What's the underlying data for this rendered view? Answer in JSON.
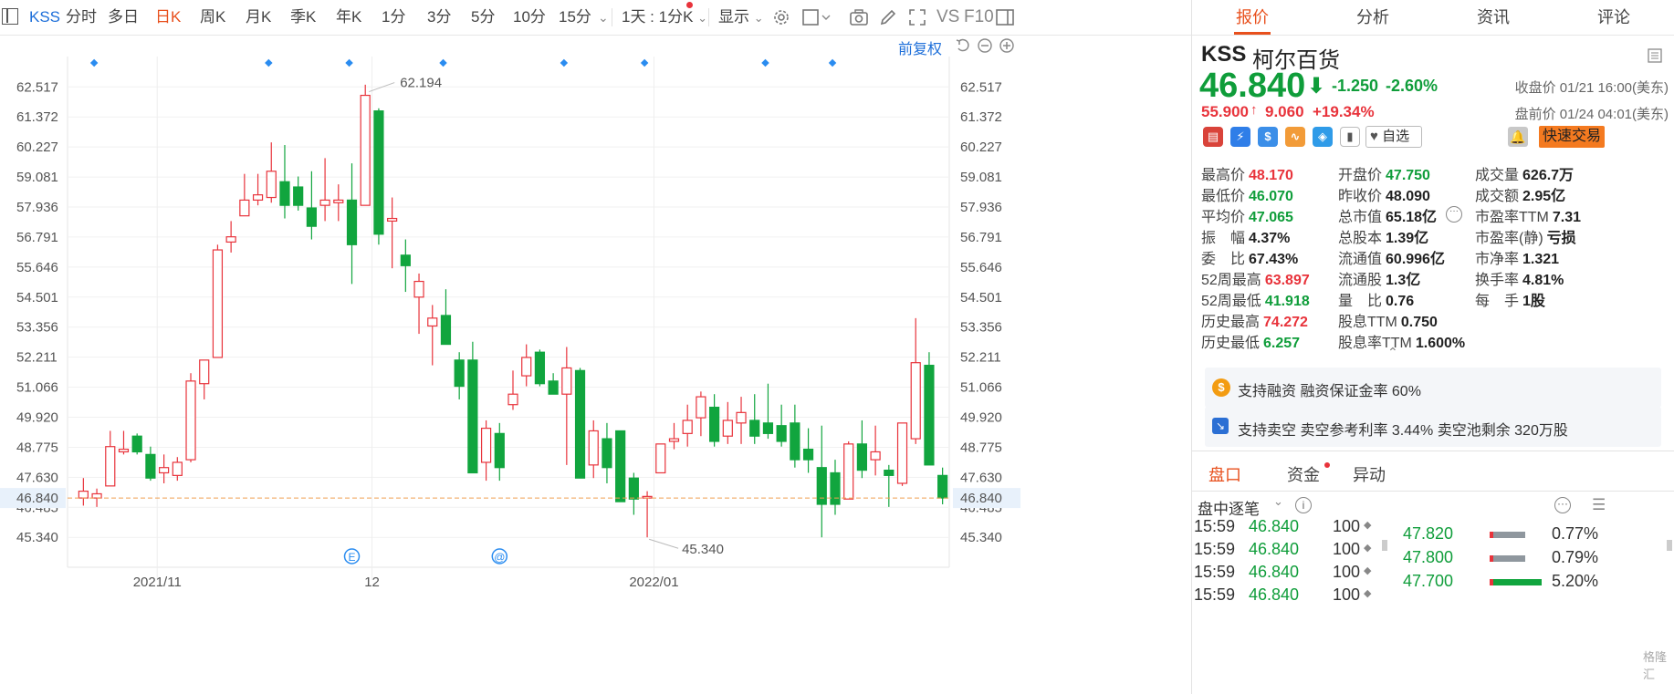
{
  "toolbar": {
    "ticker_tab": "KSS",
    "periods": [
      "分时",
      "多日",
      "日K",
      "周K",
      "月K",
      "季K",
      "年K",
      "1分",
      "3分",
      "5分",
      "10分",
      "15分"
    ],
    "active_period": "日K",
    "interval_select": "1天 : 1分K",
    "display_select": "显示",
    "vs_label": "VS",
    "f10_label": "F10"
  },
  "chart": {
    "adjust_label": "前复权",
    "last_price_label": "46.840",
    "y_ticks": [
      "62.517",
      "61.372",
      "60.227",
      "59.081",
      "57.936",
      "56.791",
      "55.646",
      "54.501",
      "53.356",
      "52.211",
      "51.066",
      "49.920",
      "48.775",
      "47.630",
      "46.485",
      "45.340"
    ],
    "x_ticks": [
      "2021/11",
      "12",
      "2022/01"
    ],
    "annot_high": "62.194",
    "annot_low": "45.340",
    "marker_e": "E",
    "marker_at": "@"
  },
  "chart_data": {
    "type": "candlestick",
    "ylim": [
      44.2,
      63.5
    ],
    "last_price": 46.84,
    "max_label": 62.194,
    "min_label": 45.34,
    "candles": [
      {
        "o": 46.84,
        "h": 47.6,
        "l": 46.55,
        "c": 47.1
      },
      {
        "o": 46.84,
        "h": 47.2,
        "l": 46.5,
        "c": 47.0
      },
      {
        "o": 47.3,
        "h": 49.4,
        "l": 47.3,
        "c": 48.8
      },
      {
        "o": 48.6,
        "h": 49.4,
        "l": 48.5,
        "c": 48.7
      },
      {
        "o": 49.2,
        "h": 49.3,
        "l": 48.5,
        "c": 48.6
      },
      {
        "o": 48.5,
        "h": 48.8,
        "l": 47.5,
        "c": 47.6
      },
      {
        "o": 47.8,
        "h": 48.5,
        "l": 47.4,
        "c": 48.0
      },
      {
        "o": 47.7,
        "h": 48.4,
        "l": 47.5,
        "c": 48.2
      },
      {
        "o": 48.3,
        "h": 51.6,
        "l": 48.2,
        "c": 51.3
      },
      {
        "o": 51.2,
        "h": 52.1,
        "l": 50.6,
        "c": 52.1
      },
      {
        "o": 52.2,
        "h": 56.5,
        "l": 52.2,
        "c": 56.3
      },
      {
        "o": 56.6,
        "h": 57.4,
        "l": 56.2,
        "c": 56.8
      },
      {
        "o": 57.6,
        "h": 59.2,
        "l": 57.6,
        "c": 58.2
      },
      {
        "o": 58.2,
        "h": 59.2,
        "l": 58.0,
        "c": 58.4
      },
      {
        "o": 58.3,
        "h": 60.4,
        "l": 58.1,
        "c": 59.3
      },
      {
        "o": 58.9,
        "h": 60.3,
        "l": 57.5,
        "c": 58.0
      },
      {
        "o": 58.7,
        "h": 59.1,
        "l": 57.8,
        "c": 58.0
      },
      {
        "o": 57.9,
        "h": 59.3,
        "l": 56.7,
        "c": 57.2
      },
      {
        "o": 58.0,
        "h": 59.8,
        "l": 57.4,
        "c": 58.2
      },
      {
        "o": 58.1,
        "h": 58.8,
        "l": 57.4,
        "c": 58.2
      },
      {
        "o": 58.2,
        "h": 59.6,
        "l": 55.0,
        "c": 56.5
      },
      {
        "o": 58.0,
        "h": 62.6,
        "l": 58.0,
        "c": 62.194
      },
      {
        "o": 61.6,
        "h": 61.7,
        "l": 56.5,
        "c": 56.9
      },
      {
        "o": 57.4,
        "h": 58.3,
        "l": 55.6,
        "c": 57.5
      },
      {
        "o": 56.1,
        "h": 56.7,
        "l": 54.7,
        "c": 55.7
      },
      {
        "o": 54.5,
        "h": 55.4,
        "l": 53.1,
        "c": 55.1
      },
      {
        "o": 53.4,
        "h": 54.2,
        "l": 51.9,
        "c": 53.7
      },
      {
        "o": 53.8,
        "h": 54.8,
        "l": 53.1,
        "c": 52.7
      },
      {
        "o": 52.1,
        "h": 52.4,
        "l": 50.6,
        "c": 51.1
      },
      {
        "o": 52.1,
        "h": 52.8,
        "l": 47.8,
        "c": 47.8
      },
      {
        "o": 48.2,
        "h": 49.8,
        "l": 47.5,
        "c": 49.5
      },
      {
        "o": 49.3,
        "h": 49.7,
        "l": 47.5,
        "c": 48.0
      },
      {
        "o": 50.4,
        "h": 51.7,
        "l": 50.2,
        "c": 50.8
      },
      {
        "o": 51.5,
        "h": 52.7,
        "l": 51.1,
        "c": 52.2
      },
      {
        "o": 52.4,
        "h": 52.5,
        "l": 51.1,
        "c": 51.2
      },
      {
        "o": 51.3,
        "h": 51.6,
        "l": 50.8,
        "c": 50.8
      },
      {
        "o": 50.8,
        "h": 52.6,
        "l": 48.1,
        "c": 51.8
      },
      {
        "o": 51.7,
        "h": 51.8,
        "l": 47.6,
        "c": 47.6
      },
      {
        "o": 48.1,
        "h": 49.8,
        "l": 47.6,
        "c": 49.4
      },
      {
        "o": 49.1,
        "h": 49.7,
        "l": 47.4,
        "c": 48.0
      },
      {
        "o": 49.4,
        "h": 49.4,
        "l": 46.7,
        "c": 46.7
      },
      {
        "o": 47.6,
        "h": 47.8,
        "l": 46.2,
        "c": 46.8
      },
      {
        "o": 46.84,
        "h": 47.1,
        "l": 45.34,
        "c": 46.9
      },
      {
        "o": 47.8,
        "h": 48.9,
        "l": 47.8,
        "c": 48.9
      },
      {
        "o": 49.0,
        "h": 49.7,
        "l": 48.7,
        "c": 49.1
      },
      {
        "o": 49.3,
        "h": 50.4,
        "l": 48.8,
        "c": 49.8
      },
      {
        "o": 49.9,
        "h": 50.9,
        "l": 49.2,
        "c": 50.7
      },
      {
        "o": 50.3,
        "h": 50.8,
        "l": 48.8,
        "c": 49.0
      },
      {
        "o": 49.2,
        "h": 50.5,
        "l": 48.9,
        "c": 49.8
      },
      {
        "o": 49.7,
        "h": 50.7,
        "l": 48.9,
        "c": 50.1
      },
      {
        "o": 49.8,
        "h": 50.8,
        "l": 48.9,
        "c": 49.2
      },
      {
        "o": 49.7,
        "h": 51.2,
        "l": 49.1,
        "c": 49.3
      },
      {
        "o": 49.6,
        "h": 50.4,
        "l": 48.8,
        "c": 49.0
      },
      {
        "o": 49.7,
        "h": 50.4,
        "l": 48.0,
        "c": 48.3
      },
      {
        "o": 48.7,
        "h": 49.5,
        "l": 47.8,
        "c": 48.3
      },
      {
        "o": 48.0,
        "h": 49.6,
        "l": 45.34,
        "c": 46.6
      },
      {
        "o": 47.8,
        "h": 48.3,
        "l": 46.2,
        "c": 46.6
      },
      {
        "o": 46.8,
        "h": 49.0,
        "l": 46.8,
        "c": 48.9
      },
      {
        "o": 48.9,
        "h": 49.8,
        "l": 47.6,
        "c": 47.9
      },
      {
        "o": 48.3,
        "h": 49.6,
        "l": 47.7,
        "c": 48.6
      },
      {
        "o": 47.9,
        "h": 48.1,
        "l": 46.5,
        "c": 47.7
      },
      {
        "o": 47.4,
        "h": 49.6,
        "l": 47.3,
        "c": 49.7
      },
      {
        "o": 49.1,
        "h": 53.7,
        "l": 48.9,
        "c": 52.0
      },
      {
        "o": 51.9,
        "h": 52.4,
        "l": 48.2,
        "c": 48.1
      },
      {
        "o": 47.7,
        "h": 48.0,
        "l": 46.6,
        "c": 46.84
      }
    ]
  },
  "quote": {
    "symbol": "KSS",
    "name": "柯尔百货",
    "price": "46.840",
    "change": "-1.250",
    "change_pct": "-2.60%",
    "close_note": "收盘价 01/21 16:00(美东)",
    "pre_price": "55.900",
    "pre_change": "9.060",
    "pre_change_pct": "+19.34%",
    "pre_note": "盘前价 01/24 04:01(美东)",
    "watchlist_label": "自选",
    "trade_button": "快速交易",
    "stats_col1": [
      {
        "k": "最高价",
        "v": "48.170",
        "c": "red"
      },
      {
        "k": "最低价",
        "v": "46.070",
        "c": "green"
      },
      {
        "k": "平均价",
        "v": "47.065",
        "c": "green"
      },
      {
        "k": "振　幅",
        "v": "4.37%",
        "c": "dark"
      },
      {
        "k": "委　比",
        "v": "67.43%",
        "c": "dark"
      },
      {
        "k": "52周最高",
        "v": "63.897",
        "c": "red"
      },
      {
        "k": "52周最低",
        "v": "41.918",
        "c": "green"
      },
      {
        "k": "历史最高",
        "v": "74.272",
        "c": "red"
      },
      {
        "k": "历史最低",
        "v": "6.257",
        "c": "green"
      }
    ],
    "stats_col2": [
      {
        "k": "开盘价",
        "v": "47.750",
        "c": "green"
      },
      {
        "k": "昨收价",
        "v": "48.090",
        "c": "dark"
      },
      {
        "k": "总市值",
        "v": "65.18亿",
        "c": "dark"
      },
      {
        "k": "总股本",
        "v": "1.39亿",
        "c": "dark"
      },
      {
        "k": "流通值",
        "v": "60.996亿",
        "c": "dark"
      },
      {
        "k": "流通股",
        "v": "1.3亿",
        "c": "dark"
      },
      {
        "k": "量　比",
        "v": "0.76",
        "c": "dark"
      },
      {
        "k": "股息TTM",
        "v": "0.750",
        "c": "dark"
      },
      {
        "k": "股息率TTM",
        "v": "1.600%",
        "c": "dark"
      }
    ],
    "stats_col3": [
      {
        "k": "成交量",
        "v": "626.7万",
        "c": "dark"
      },
      {
        "k": "成交额",
        "v": "2.95亿",
        "c": "dark"
      },
      {
        "k": "市盈率TTM",
        "v": "7.31",
        "c": "dark"
      },
      {
        "k": "市盈率(静)",
        "v": "亏损",
        "c": "dark"
      },
      {
        "k": "市净率",
        "v": "1.321",
        "c": "dark"
      },
      {
        "k": "换手率",
        "v": "4.81%",
        "c": "dark"
      },
      {
        "k": "每　手",
        "v": "1股",
        "c": "dark"
      }
    ],
    "margin_info": "支持融资 融资保证金率 60%",
    "short_info": "支持卖空 卖空参考利率 3.44% 卖空池剩余 320万股"
  },
  "right_tabs": [
    "报价",
    "分析",
    "资讯",
    "评论"
  ],
  "sub_tabs": [
    "盘口",
    "资金",
    "异动"
  ],
  "ticks_title": "盘中逐笔",
  "ticks": [
    {
      "time": "15:59",
      "price": "46.840",
      "vol": "100"
    },
    {
      "time": "15:59",
      "price": "46.840",
      "vol": "100"
    },
    {
      "time": "15:59",
      "price": "46.840",
      "vol": "100"
    },
    {
      "time": "15:59",
      "price": "46.840",
      "vol": "100"
    }
  ],
  "levels": [
    {
      "price": "47.820",
      "pct": "0.77%"
    },
    {
      "price": "47.800",
      "pct": "0.79%"
    },
    {
      "price": "47.700",
      "pct": "5.20%"
    }
  ],
  "watermark": "格隆汇"
}
